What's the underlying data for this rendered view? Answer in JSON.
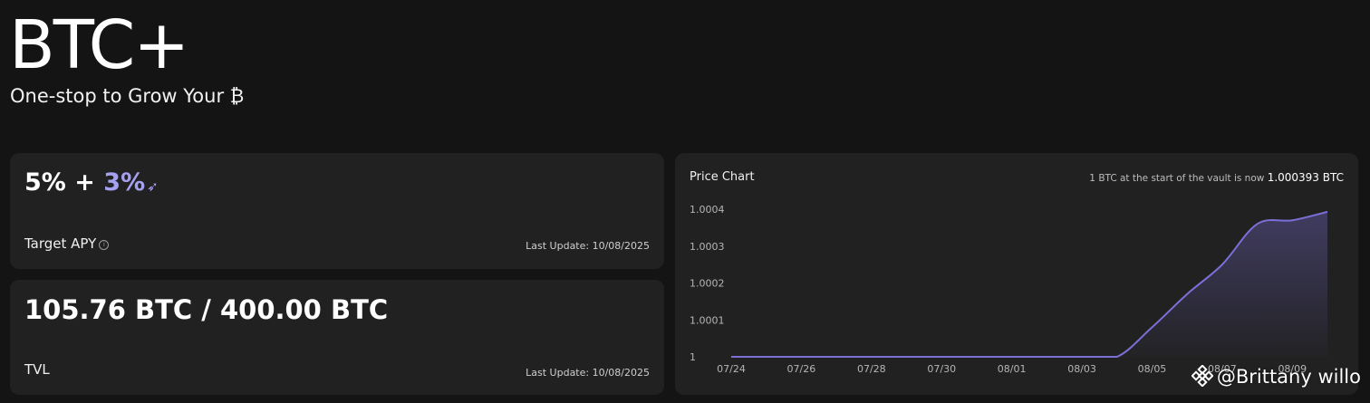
{
  "header": {
    "title": "BTC+",
    "subtitle": "One-stop to Grow Your ₿"
  },
  "apy_card": {
    "base": "5%",
    "plus": "+",
    "bonus": "3%",
    "bonus_icon": "rocket-arrow-icon",
    "label": "Target APY",
    "info_icon": "info-icon",
    "last_update": "Last Update: 10/08/2025"
  },
  "tvl_card": {
    "value": "105.76 BTC / 400.00 BTC",
    "label": "TVL",
    "last_update": "Last Update: 10/08/2025"
  },
  "price_chart": {
    "title": "Price Chart",
    "note_prefix": "1 BTC at the start of the vault is now",
    "note_value": "1.000393 BTC"
  },
  "watermark": {
    "icon": "binance-logo-icon",
    "text": "@Brittany willo"
  },
  "colors": {
    "background": "#141414",
    "card": "#212121",
    "accent": "#a5a0f0",
    "line": "#7b6fd8"
  },
  "chart_data": {
    "type": "area",
    "x": [
      "07/24",
      "07/25",
      "07/26",
      "07/27",
      "07/28",
      "07/29",
      "07/30",
      "07/31",
      "08/01",
      "08/02",
      "08/03",
      "08/04",
      "08/05",
      "08/06",
      "08/07",
      "08/08",
      "08/09",
      "08/10"
    ],
    "x_ticks": [
      "07/24",
      "07/26",
      "07/28",
      "07/30",
      "08/01",
      "08/03",
      "08/05",
      "08/07",
      "08/09"
    ],
    "values": [
      1,
      1,
      1,
      1,
      1,
      1,
      1,
      1,
      1,
      1,
      1,
      1.0,
      1.00008,
      1.00017,
      1.00025,
      1.00036,
      1.00037,
      1.000393
    ],
    "ylim": [
      1,
      1.0004
    ],
    "y_ticks": [
      "1",
      "1.0001",
      "1.0002",
      "1.0003",
      "1.0004"
    ],
    "grid": false,
    "legend": "none"
  }
}
